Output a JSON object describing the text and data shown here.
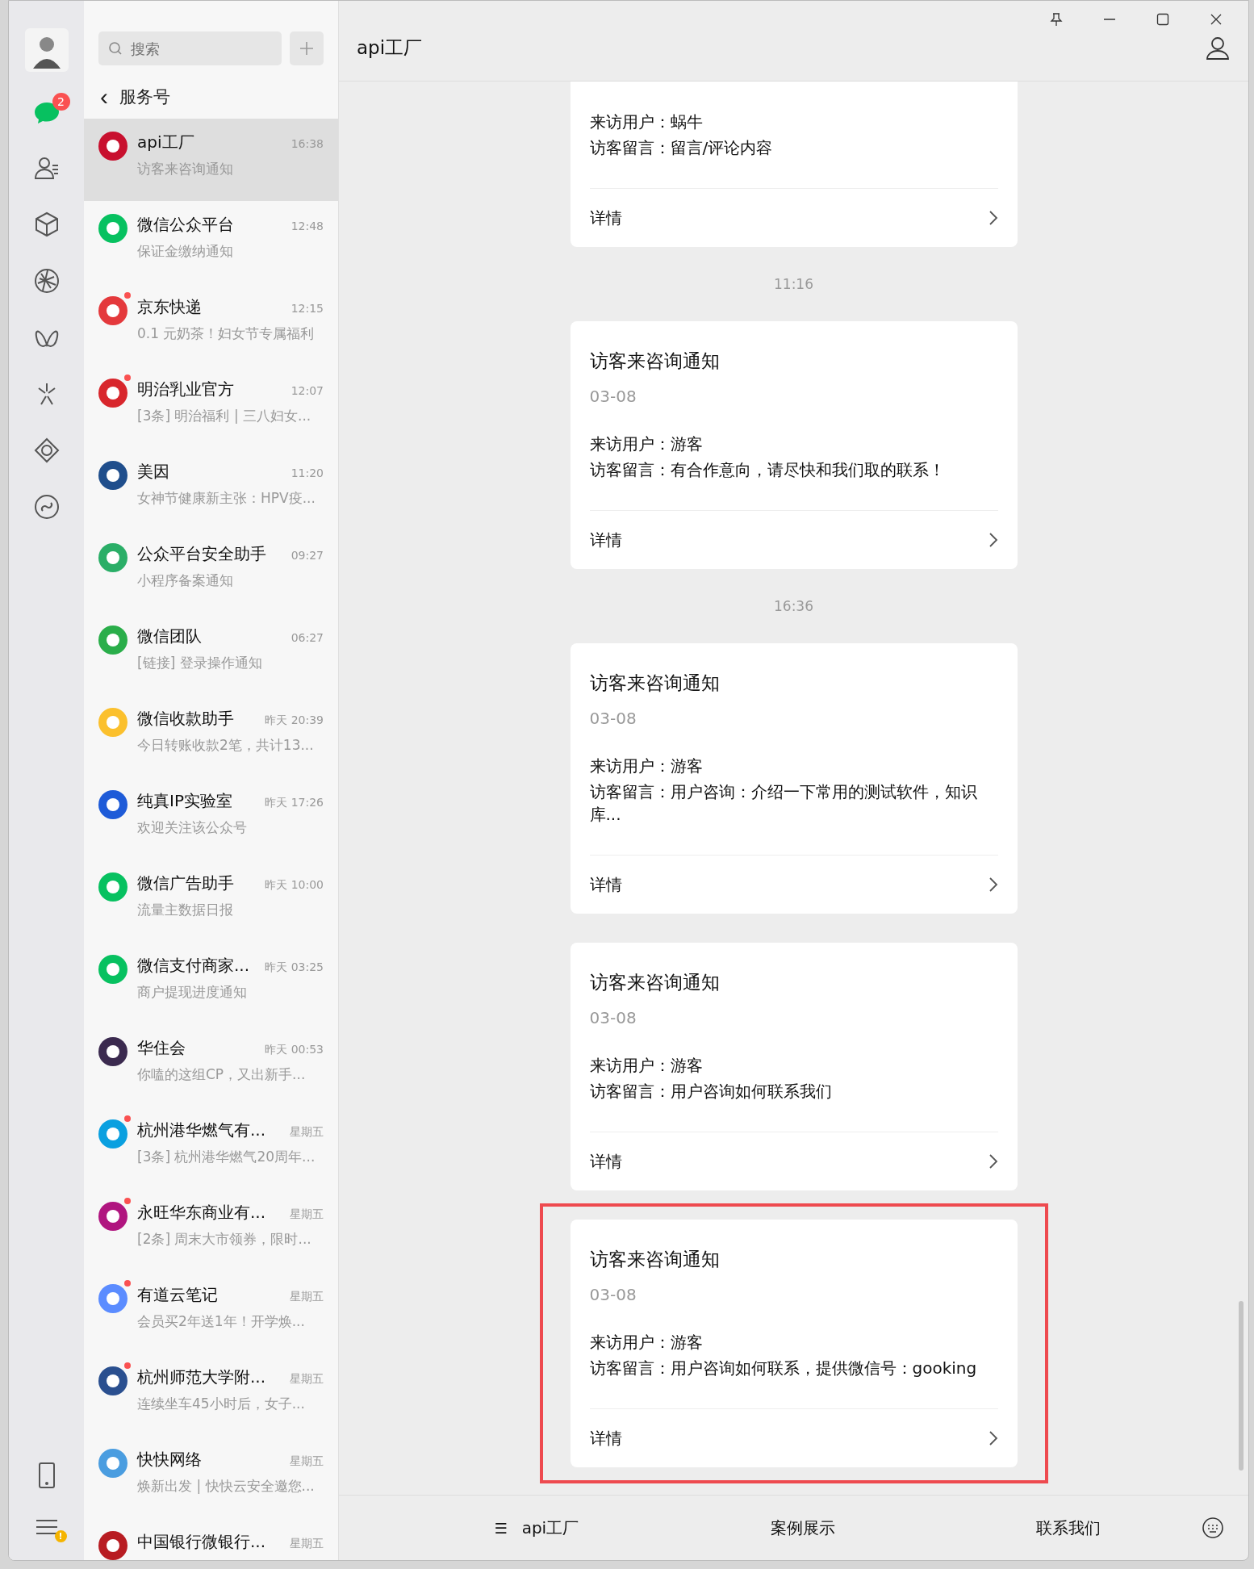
{
  "rail": {
    "chat_badge": "2",
    "menu_badge": "!"
  },
  "search": {
    "placeholder": "搜索"
  },
  "list_header": {
    "back": "‹",
    "title": "服务号"
  },
  "conversations": [
    {
      "name": "api工厂",
      "time": "16:38",
      "preview": "访客来咨询通知",
      "selected": true,
      "unread": false,
      "color": "#c8102e"
    },
    {
      "name": "微信公众平台",
      "time": "12:48",
      "preview": "保证金缴纳通知",
      "selected": false,
      "unread": false,
      "color": "#07c160"
    },
    {
      "name": "京东快递",
      "time": "12:15",
      "preview": "0.1 元奶茶！妇女节专属福利",
      "selected": false,
      "unread": true,
      "color": "#e4393c"
    },
    {
      "name": "明治乳业官方",
      "time": "12:07",
      "preview": "[3条] 明治福利 | 三八妇女...",
      "selected": false,
      "unread": true,
      "color": "#d8262c"
    },
    {
      "name": "美因",
      "time": "11:20",
      "preview": "女神节健康新主张：HPV疫...",
      "selected": false,
      "unread": false,
      "color": "#1f4e8c"
    },
    {
      "name": "公众平台安全助手",
      "time": "09:27",
      "preview": "小程序备案通知",
      "selected": false,
      "unread": false,
      "color": "#2aae67"
    },
    {
      "name": "微信团队",
      "time": "06:27",
      "preview": "[链接] 登录操作通知",
      "selected": false,
      "unread": false,
      "color": "#2aae4a"
    },
    {
      "name": "微信收款助手",
      "time": "昨天 20:39",
      "preview": "今日转账收款2笔，共计13...",
      "selected": false,
      "unread": false,
      "color": "#fbc02d"
    },
    {
      "name": "纯真IP实验室",
      "time": "昨天 17:26",
      "preview": "欢迎关注该公众号",
      "selected": false,
      "unread": false,
      "color": "#1e5bd8"
    },
    {
      "name": "微信广告助手",
      "time": "昨天 10:00",
      "preview": "流量主数据日报",
      "selected": false,
      "unread": false,
      "color": "#07c160"
    },
    {
      "name": "微信支付商家...",
      "time": "昨天 03:25",
      "preview": "商户提现进度通知",
      "selected": false,
      "unread": false,
      "color": "#07c160"
    },
    {
      "name": "华住会",
      "time": "昨天 00:53",
      "preview": "你嗑的这组CP，又出新手...",
      "selected": false,
      "unread": false,
      "color": "#3b2a4f"
    },
    {
      "name": "杭州港华燃气有...",
      "time": "星期五",
      "preview": "[3条] 杭州港华燃气20周年...",
      "selected": false,
      "unread": true,
      "color": "#0aa0e0"
    },
    {
      "name": "永旺华东商业有...",
      "time": "星期五",
      "preview": "[2条] 周末大市领券，限时...",
      "selected": false,
      "unread": true,
      "color": "#b0157f"
    },
    {
      "name": "有道云笔记",
      "time": "星期五",
      "preview": "会员买2年送1年！开学焕...",
      "selected": false,
      "unread": true,
      "color": "#5b8cff"
    },
    {
      "name": "杭州师范大学附...",
      "time": "星期五",
      "preview": "连续坐车45小时后，女子...",
      "selected": false,
      "unread": true,
      "color": "#2a4f8f"
    },
    {
      "name": "快快网络",
      "time": "星期五",
      "preview": "焕新出发 | 快快云安全邀您...",
      "selected": false,
      "unread": false,
      "color": "#4a9de0"
    },
    {
      "name": "中国银行微银行...",
      "time": "星期五",
      "selected": false,
      "unread": false,
      "color": "#b81c22"
    }
  ],
  "chat": {
    "title": "api工厂",
    "messages": [
      {
        "kind": "card",
        "user": "来访用户：蜗牛",
        "note": "访客留言：留言/评论内容",
        "link": "详情",
        "highlighted": false
      },
      {
        "kind": "time",
        "text": "11:16"
      },
      {
        "kind": "card",
        "title": "访客来咨询通知",
        "date": "03-08",
        "user": "来访用户：游客",
        "note": "访客留言：有合作意向，请尽快和我们取的联系！",
        "link": "详情",
        "highlighted": false
      },
      {
        "kind": "time",
        "text": "16:36"
      },
      {
        "kind": "card",
        "title": "访客来咨询通知",
        "date": "03-08",
        "user": "来访用户：游客",
        "note": "访客留言：用户咨询：介绍一下常用的测试软件，知识库...",
        "link": "详情",
        "highlighted": false
      },
      {
        "kind": "card",
        "title": "访客来咨询通知",
        "date": "03-08",
        "user": "来访用户：游客",
        "note": "访客留言：用户咨询如何联系我们",
        "link": "详情",
        "highlighted": false
      },
      {
        "kind": "card",
        "title": "访客来咨询通知",
        "date": "03-08",
        "user": "来访用户：游客",
        "note": "访客留言：用户咨询如何联系，提供微信号：gooking",
        "link": "详情",
        "highlighted": true
      }
    ],
    "menu": [
      {
        "icon": "☰",
        "label": "api工厂"
      },
      {
        "label": "案例展示"
      },
      {
        "label": "联系我们"
      }
    ]
  }
}
